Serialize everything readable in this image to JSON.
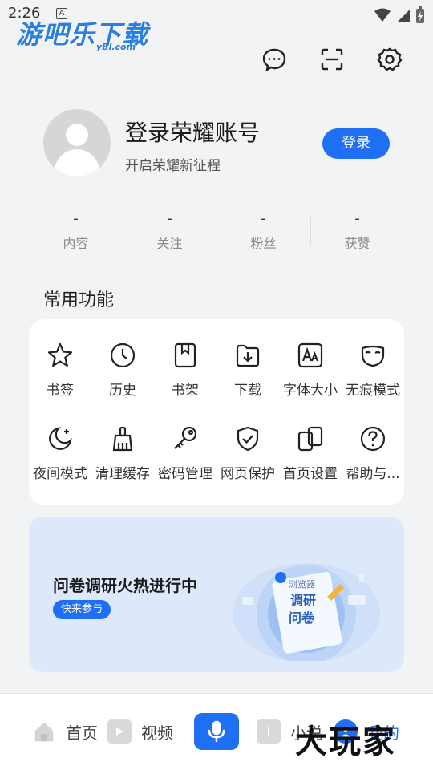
{
  "status": {
    "time": "2:26",
    "a_badge": "A"
  },
  "watermark": {
    "text": "游吧乐下载",
    "sub": "yBl.com"
  },
  "profile": {
    "name": "登录荣耀账号",
    "subtitle": "开启荣耀新征程",
    "login_label": "登录"
  },
  "stats": [
    {
      "value": "-",
      "label": "内容"
    },
    {
      "value": "-",
      "label": "关注"
    },
    {
      "value": "-",
      "label": "粉丝"
    },
    {
      "value": "-",
      "label": "获赞"
    }
  ],
  "functions": {
    "title": "常用功能",
    "items": [
      {
        "label": "书签",
        "icon": "star-icon"
      },
      {
        "label": "历史",
        "icon": "clock-icon"
      },
      {
        "label": "书架",
        "icon": "bookshelf-icon"
      },
      {
        "label": "下载",
        "icon": "download-icon"
      },
      {
        "label": "字体大小",
        "icon": "font-size-icon"
      },
      {
        "label": "无痕模式",
        "icon": "mask-icon"
      },
      {
        "label": "夜间模式",
        "icon": "moon-icon"
      },
      {
        "label": "清理缓存",
        "icon": "broom-icon"
      },
      {
        "label": "密码管理",
        "icon": "key-icon"
      },
      {
        "label": "网页保护",
        "icon": "shield-icon"
      },
      {
        "label": "首页设置",
        "icon": "homepage-settings-icon"
      },
      {
        "label": "帮助与...",
        "icon": "help-icon"
      }
    ]
  },
  "banner": {
    "title": "问卷调研火热进行中",
    "button": "快来参与",
    "art_text": [
      "浏览器",
      "调研",
      "问卷"
    ]
  },
  "nav": {
    "home": "首页",
    "video": "视频",
    "novel": "小说",
    "mine": "我的"
  },
  "watermark2": "大玩家",
  "colors": {
    "accent": "#1f6ff5",
    "background": "#f1f3f5",
    "banner": "#dde9fb"
  }
}
